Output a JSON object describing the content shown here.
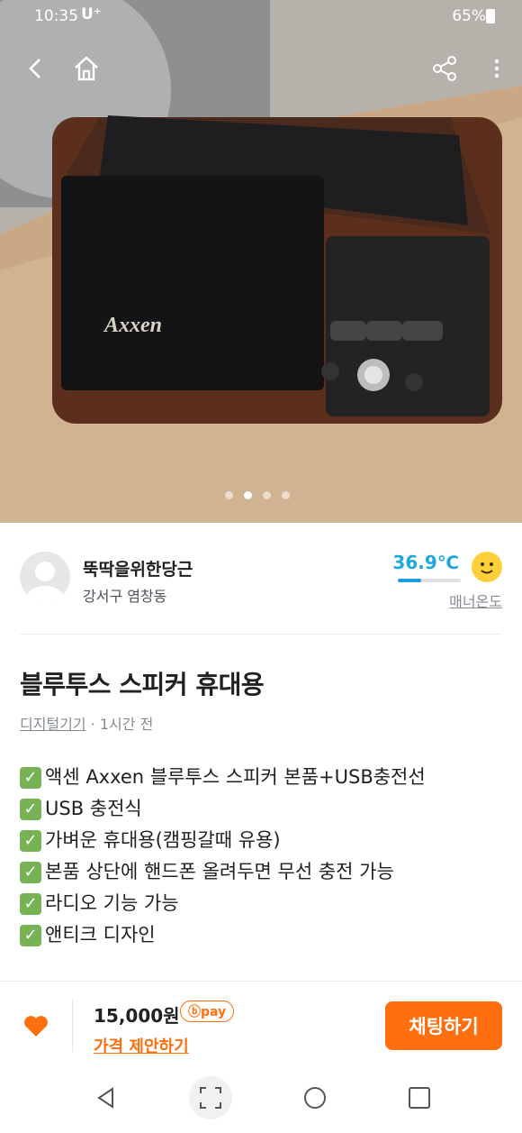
{
  "status": {
    "time": "10:35",
    "carrier": "U⁺",
    "battery": "65%"
  },
  "photo": {
    "logo": "Axxen",
    "slide_count": 4,
    "active_slide": 2
  },
  "seller": {
    "name": "뚝딱을위한당근",
    "location": "강서구 염창동",
    "temperature": "36.9℃",
    "temperature_level": 0.369,
    "manner_label": "매너온도"
  },
  "post": {
    "title": "블루투스 스피커 휴대용",
    "category": "디지털기기",
    "time_ago": "· 1시간 전",
    "description": [
      "액센 Axxen 블루투스 스피커 본품+USB충전선",
      "USB 충전식",
      "가벼운 휴대용(캠핑갈때 유용)",
      "본품 상단에 핸드폰 올려두면 무선 충전 가능",
      "라디오 기능 가능",
      "앤티크 디자인"
    ]
  },
  "bottom": {
    "price": "15,000원",
    "pay_badge": "ⓑpay",
    "offer": "가격 제안하기",
    "chat": "채팅하기"
  },
  "colors": {
    "accent": "#ff6f0f",
    "temperature": "#1ea8e0"
  }
}
